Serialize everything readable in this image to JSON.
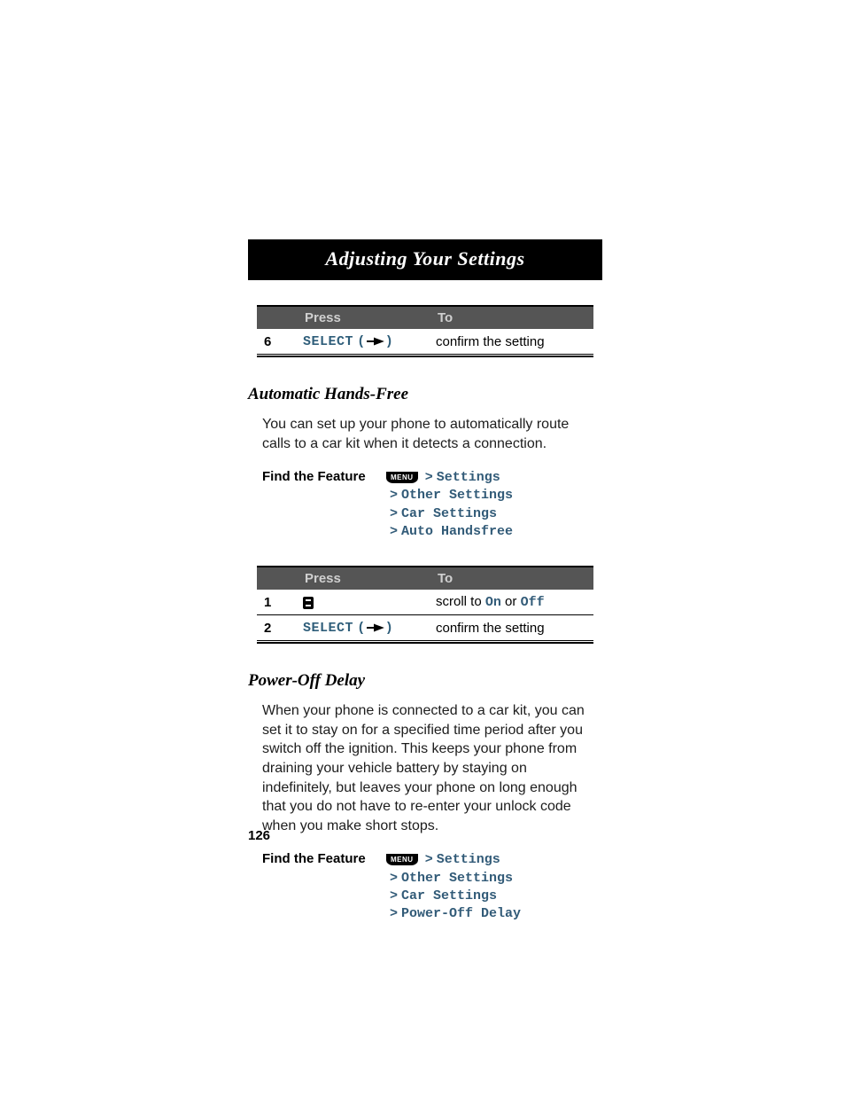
{
  "title": "Adjusting Your Settings",
  "page_number": "126",
  "table1": {
    "headers": {
      "press": "Press",
      "to": "To"
    },
    "rows": [
      {
        "step": "6",
        "press": "SELECT",
        "to": "confirm the setting"
      }
    ]
  },
  "section1": {
    "heading": "Automatic Hands-Free",
    "body": "You can set up your phone to automatically route calls to a car kit when it detects a connection.",
    "find_label": "Find the Feature",
    "menu_label": "MENU",
    "path": [
      "Settings",
      "Other Settings",
      "Car Settings",
      "Auto Handsfree"
    ]
  },
  "table2": {
    "headers": {
      "press": "Press",
      "to": "To"
    },
    "rows": [
      {
        "step": "1",
        "to_pre": "scroll to ",
        "to_opt1": "On",
        "to_mid": " or ",
        "to_opt2": "Off"
      },
      {
        "step": "2",
        "press": "SELECT",
        "to": "confirm the setting"
      }
    ]
  },
  "section2": {
    "heading": "Power-Off Delay",
    "body": "When your phone is connected to a car kit, you can set it to stay on for a specified time period after you switch off the ignition. This keeps your phone from draining your vehicle battery by staying on indefinitely, but leaves your phone on long enough that you do not have to re-enter your unlock code when you make short stops.",
    "find_label": "Find the Feature",
    "menu_label": "MENU",
    "path": [
      "Settings",
      "Other Settings",
      "Car Settings",
      "Power-Off Delay"
    ]
  }
}
